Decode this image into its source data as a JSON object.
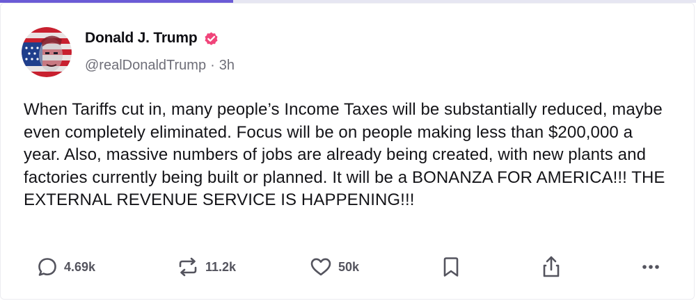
{
  "post": {
    "author": {
      "display_name": "Donald J. Trump",
      "handle": "@realDonaldTrump",
      "separator": "·",
      "time": "3h",
      "verified_icon": "verified-badge-icon",
      "verified_color": "#f0457a",
      "avatar_icon": "avatar-flag-portrait"
    },
    "text": "When Tariffs cut in, many people’s Income Taxes will be substantially reduced, maybe even completely eliminated. Focus will be on people making less than $200,000 a year. Also, massive numbers of jobs are already being created, with new plants and factories currently being built or planned. It will be a BONANZA FOR AMERICA!!! THE EXTERNAL REVENUE SERVICE IS HAPPENING!!!",
    "actions": {
      "reply": {
        "icon": "reply-icon",
        "count": "4.69k"
      },
      "repost": {
        "icon": "repost-icon",
        "count": "11.2k"
      },
      "like": {
        "icon": "heart-icon",
        "count": "50k"
      },
      "bookmark": {
        "icon": "bookmark-icon"
      },
      "share": {
        "icon": "share-icon"
      },
      "more": {
        "icon": "more-icon"
      }
    }
  },
  "top_progress": {
    "fraction": 0.335,
    "color": "#6b5bd6"
  }
}
